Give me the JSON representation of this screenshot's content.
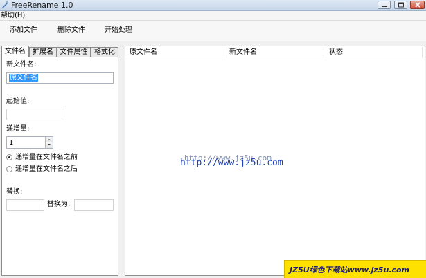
{
  "window": {
    "title": "FreeRename 1.0"
  },
  "menu": {
    "items": [
      {
        "label": "帮助(H)"
      }
    ]
  },
  "toolbar": {
    "add_label": "添加文件",
    "delete_label": "删除文件",
    "start_label": "开始处理"
  },
  "tabs": [
    {
      "label": "文件名",
      "active": true
    },
    {
      "label": "扩展名",
      "active": false
    },
    {
      "label": "文件属性",
      "active": false
    },
    {
      "label": "格式化",
      "active": false
    }
  ],
  "filename_tab": {
    "new_name_label": "新文件名:",
    "new_name_value": "原文件名",
    "start_label": "起始值:",
    "start_value": "",
    "increment_label": "递增量:",
    "increment_value": "1",
    "radio_before": {
      "label": "递增量在文件名之前",
      "checked": true
    },
    "radio_after": {
      "label": "递增量在文件名之后",
      "checked": false
    },
    "replace_label": "替换:",
    "replace_value": "",
    "replace_with_label": "替换为:",
    "replace_with_value": ""
  },
  "file_list": {
    "columns": [
      "原文件名",
      "新文件名",
      "状态"
    ],
    "rows": []
  },
  "watermark": {
    "url_text": "http://www.jz5u.com",
    "corner_text": "JZ5U绿色下载站www.jz5u.com"
  },
  "colors": {
    "selection": "#3399ff",
    "watermark_blue": "#1a3fbf",
    "corner_bg": "#ffe100"
  }
}
